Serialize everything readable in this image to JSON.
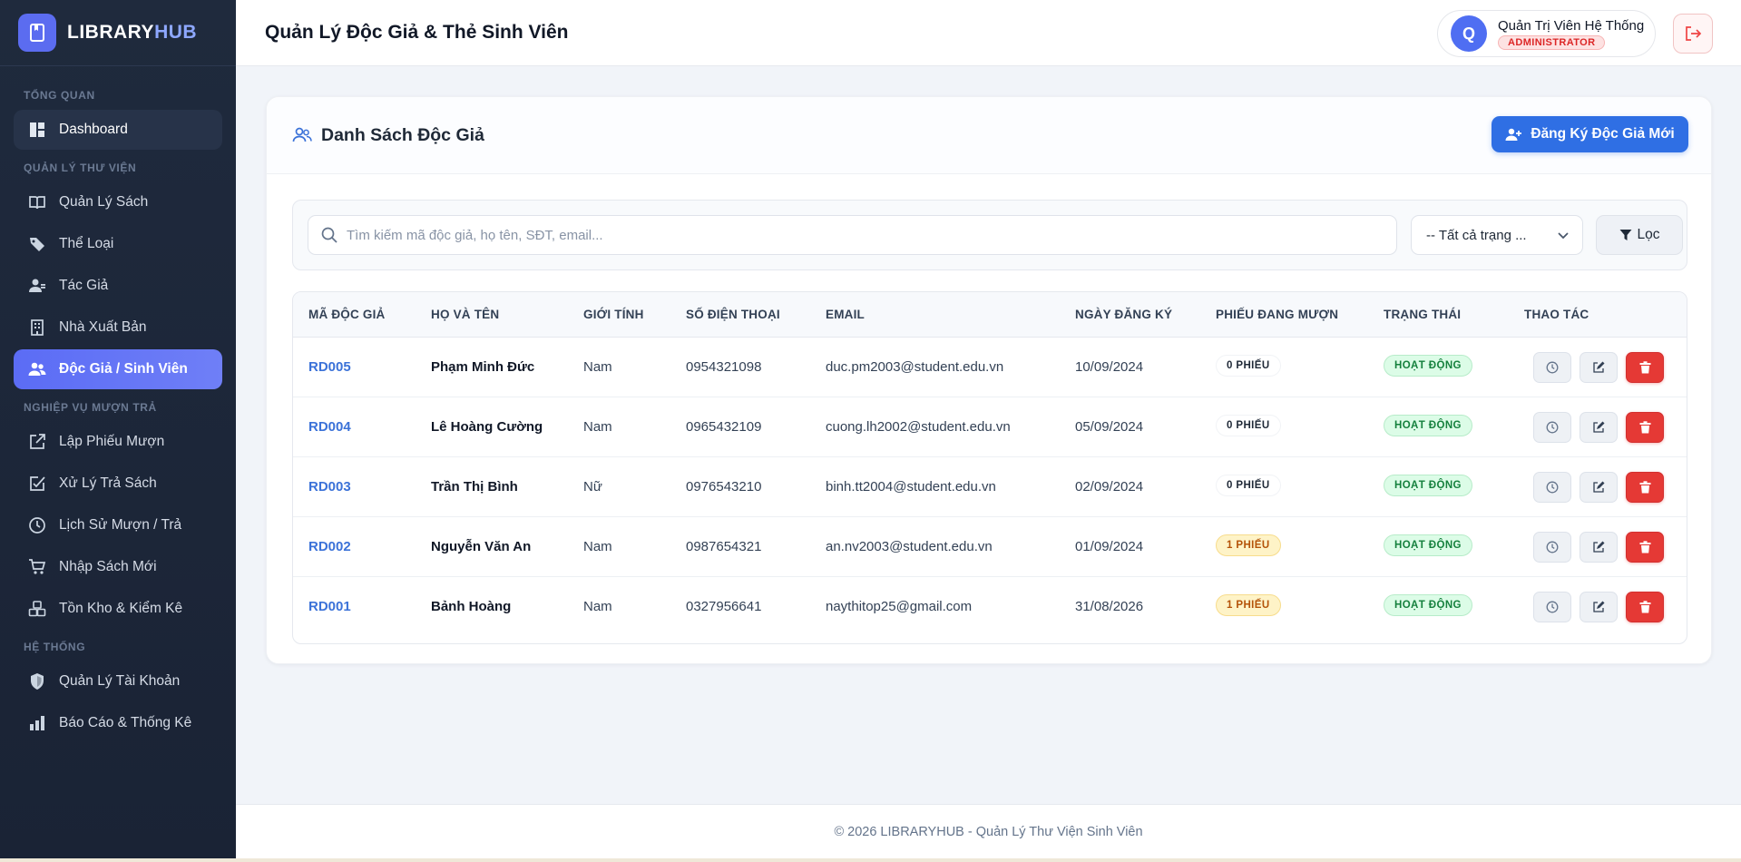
{
  "app": {
    "brand_main": "LIBRARY",
    "brand_accent": "HUB"
  },
  "sidebar": {
    "sections": [
      {
        "title": "TỔNG QUAN"
      },
      {
        "title": "QUẢN LÝ THƯ VIỆN"
      },
      {
        "title": "NGHIỆP VỤ MƯỢN TRẢ"
      },
      {
        "title": "HỆ THỐNG"
      }
    ],
    "items": [
      {
        "label": "Dashboard",
        "icon": "dashboard-icon"
      },
      {
        "label": "Quản Lý Sách",
        "icon": "book-open-icon"
      },
      {
        "label": "Thể Loại",
        "icon": "tag-icon"
      },
      {
        "label": "Tác Giả",
        "icon": "user-tie-icon"
      },
      {
        "label": "Nhà Xuất Bản",
        "icon": "building-icon"
      },
      {
        "label": "Độc Giả / Sinh Viên",
        "icon": "users-icon",
        "active": true
      },
      {
        "label": "Lập Phiếu Mượn",
        "icon": "external-link-icon"
      },
      {
        "label": "Xử Lý Trả Sách",
        "icon": "check-square-icon"
      },
      {
        "label": "Lịch Sử Mượn / Trả",
        "icon": "clock-icon"
      },
      {
        "label": "Nhập Sách Mới",
        "icon": "cart-icon"
      },
      {
        "label": "Tồn Kho & Kiểm Kê",
        "icon": "boxes-icon"
      },
      {
        "label": "Quản Lý Tài Khoản",
        "icon": "shield-icon"
      },
      {
        "label": "Báo Cáo & Thống Kê",
        "icon": "bar-chart-icon"
      }
    ]
  },
  "header": {
    "title": "Quản Lý Độc Giả & Thẻ Sinh Viên",
    "user": {
      "initial": "Q",
      "name": "Quản Trị Viên Hệ Thống",
      "role": "ADMINISTRATOR"
    }
  },
  "card": {
    "title": "Danh Sách Độc Giả",
    "add_button": "Đăng Ký Độc Giả Mới"
  },
  "filters": {
    "search_placeholder": "Tìm kiếm mã độc giả, họ tên, SĐT, email...",
    "status_value": "-- Tất cả trạng ...",
    "filter_button": "Lọc"
  },
  "table": {
    "columns": [
      "MÃ ĐỘC GIẢ",
      "HỌ VÀ TÊN",
      "GIỚI TÍNH",
      "SỐ ĐIỆN THOẠI",
      "EMAIL",
      "NGÀY ĐĂNG KÝ",
      "PHIẾU ĐANG MƯỢN",
      "TRẠNG THÁI",
      "THAO TÁC"
    ],
    "rows": [
      {
        "code": "RD005",
        "name": "Phạm Minh Đức",
        "gender": "Nam",
        "phone": "0954321098",
        "email": "duc.pm2003@student.edu.vn",
        "date": "10/09/2024",
        "loans": "0 PHIẾU",
        "loan_count": 0,
        "status": "HOẠT ĐỘNG"
      },
      {
        "code": "RD004",
        "name": "Lê Hoàng Cường",
        "gender": "Nam",
        "phone": "0965432109",
        "email": "cuong.lh2002@student.edu.vn",
        "date": "05/09/2024",
        "loans": "0 PHIẾU",
        "loan_count": 0,
        "status": "HOẠT ĐỘNG"
      },
      {
        "code": "RD003",
        "name": "Trần Thị Bình",
        "gender": "Nữ",
        "phone": "0976543210",
        "email": "binh.tt2004@student.edu.vn",
        "date": "02/09/2024",
        "loans": "0 PHIẾU",
        "loan_count": 0,
        "status": "HOẠT ĐỘNG"
      },
      {
        "code": "RD002",
        "name": "Nguyễn Văn An",
        "gender": "Nam",
        "phone": "0987654321",
        "email": "an.nv2003@student.edu.vn",
        "date": "01/09/2024",
        "loans": "1 PHIẾU",
        "loan_count": 1,
        "status": "HOẠT ĐỘNG"
      },
      {
        "code": "RD001",
        "name": "Bảnh Hoàng",
        "gender": "Nam",
        "phone": "0327956641",
        "email": "naythitop25@gmail.com",
        "date": "31/08/2026",
        "loans": "1 PHIẾU",
        "loan_count": 1,
        "status": "HOẠT ĐỘNG"
      }
    ]
  },
  "footer": {
    "text": "© 2026 LIBRARYHUB - Quản Lý Thư Viện Sinh Viên"
  },
  "colors": {
    "primary": "#2f6fe4",
    "sidebar_bg": "#1f2a3d",
    "active_nav": "#5b6cf5",
    "danger": "#e53935",
    "success": "#15803d"
  }
}
